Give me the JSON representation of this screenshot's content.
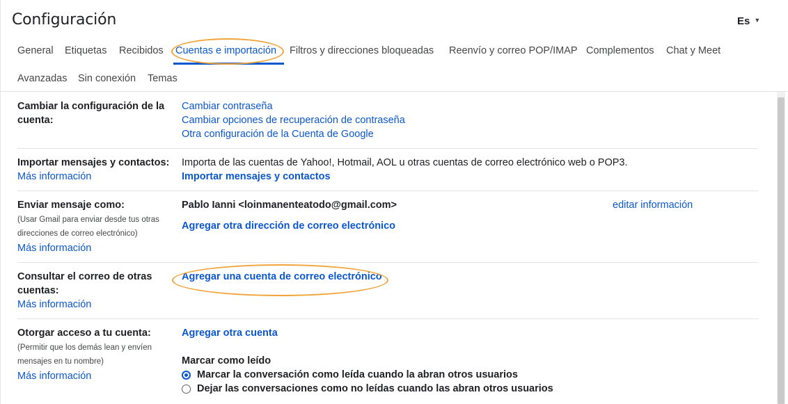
{
  "header": {
    "title": "Configuración",
    "language": "Es"
  },
  "tabs": [
    {
      "label": "General",
      "active": false
    },
    {
      "label": "Etiquetas",
      "active": false
    },
    {
      "label": "Recibidos",
      "active": false
    },
    {
      "label": "Cuentas e importación",
      "active": true
    },
    {
      "label": "Filtros y direcciones bloqueadas",
      "active": false
    },
    {
      "label": "Reenvío y correo POP/IMAP",
      "active": false
    },
    {
      "label": "Complementos",
      "active": false
    },
    {
      "label": "Chat y Meet",
      "active": false
    },
    {
      "label": "Avanzadas",
      "active": false
    },
    {
      "label": "Sin conexión",
      "active": false
    },
    {
      "label": "Temas",
      "active": false
    }
  ],
  "sections": {
    "account": {
      "label": "Cambiar la configuración de la cuenta:",
      "links": [
        "Cambiar contraseña",
        "Cambiar opciones de recuperación de contraseña",
        "Otra configuración de la Cuenta de Google"
      ]
    },
    "import": {
      "label": "Importar mensajes y contactos:",
      "more": "Más información",
      "description": "Importa de las cuentas de Yahoo!, Hotmail, AOL u otras cuentas de correo electrónico web o POP3.",
      "action": "Importar mensajes y contactos"
    },
    "send_as": {
      "label": "Enviar mensaje como:",
      "note": "(Usar Gmail para enviar desde tus otras direcciones de correo electrónico)",
      "more": "Más información",
      "address": "Pablo Ianni <loinmanenteatodo@gmail.com>",
      "edit": "editar información",
      "action": "Agregar otra dirección de correo electrónico"
    },
    "check_mail": {
      "label": "Consultar el correo de otras cuentas:",
      "more": "Más información",
      "action": "Agregar una cuenta de correo electrónico"
    },
    "grant_access": {
      "label": "Otorgar acceso a tu cuenta:",
      "note": "(Permitir que los demás lean y envíen mensajes en tu nombre)",
      "more": "Más información",
      "action": "Agregar otra cuenta",
      "mark_read_title": "Marcar como leído",
      "options": [
        {
          "label": "Marcar la conversación como leída cuando la abran otros usuarios",
          "selected": true
        },
        {
          "label": "Dejar las conversaciones como no leídas cuando las abran otros usuarios",
          "selected": false
        }
      ]
    }
  },
  "colors": {
    "accent": "#0b57d0",
    "highlight": "#f0a43a"
  }
}
